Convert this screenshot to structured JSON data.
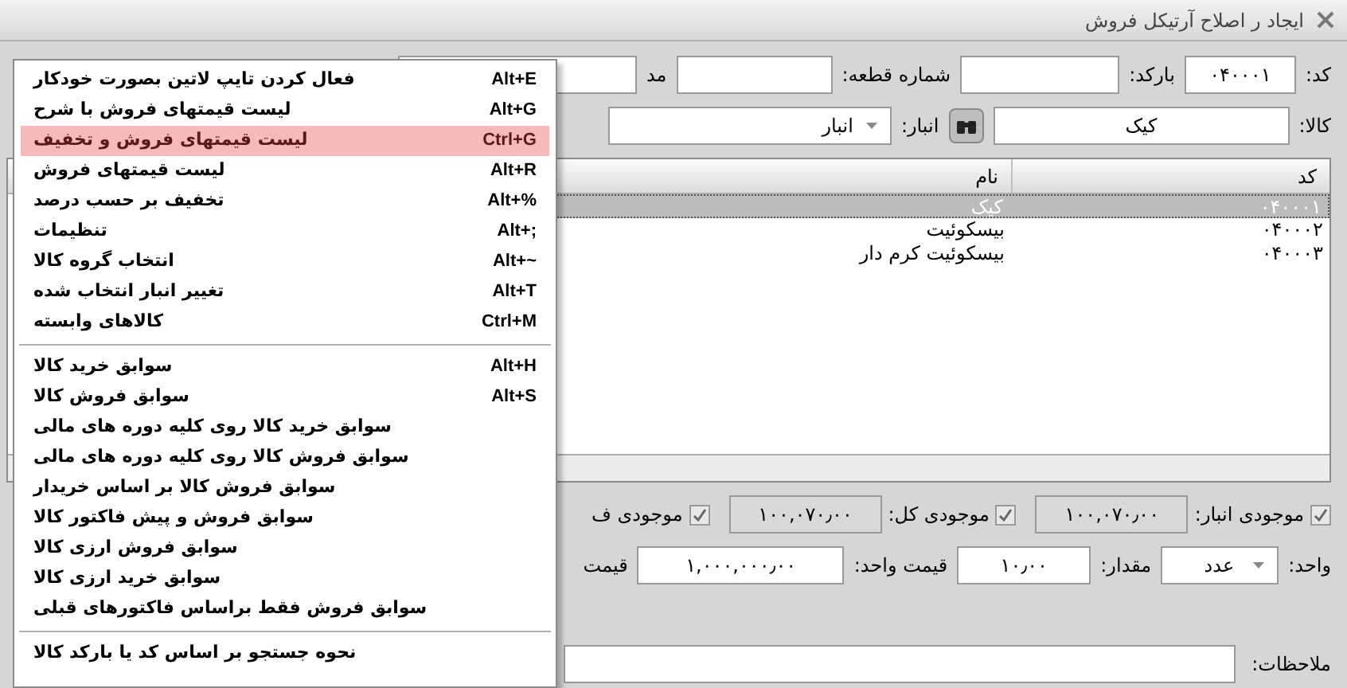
{
  "window": {
    "title": "ایجاد ر اصلاح آرتیکل فروش"
  },
  "row1": [
    {
      "label": "کد:",
      "value": "۰۴۰۰۰۱"
    },
    {
      "label": "بارکد:"
    },
    {
      "label": "شماره قطعه:"
    },
    {
      "label": "مد"
    }
  ],
  "item": {
    "label": "کالا:",
    "value": "کیک"
  },
  "warehouse": {
    "label": "انبار:",
    "value": "انبار"
  },
  "table": {
    "columns": [
      "کد",
      "نام"
    ],
    "rows": [
      {
        "code": "۰۴۰۰۰۱",
        "name": "کیک",
        "selected": true
      },
      {
        "code": "۰۴۰۰۰۲",
        "name": "بیسکوئیت",
        "selected": false
      },
      {
        "code": "۰۴۰۰۰۳",
        "name": "بیسکوئیت کرم دار",
        "selected": false
      }
    ]
  },
  "stock": [
    {
      "label": "موجودی انبار:",
      "checked": true,
      "value": "۱۰۰,۰۷۰٫۰۰"
    },
    {
      "label": "موجودی کل:",
      "checked": true,
      "value": "۱۰۰,۰۷۰٫۰۰"
    },
    {
      "label": "موجودی ف",
      "checked": true
    }
  ],
  "unit": {
    "label": "واحد:",
    "value": "عدد"
  },
  "quantity": {
    "label": "مقدار:",
    "value": "۱۰٫۰۰"
  },
  "unit_price": {
    "label": "قیمت واحد:",
    "value": "۱,۰۰۰,۰۰۰٫۰۰"
  },
  "price_cut": "قیمت",
  "notes": {
    "label": "ملاحظات:"
  },
  "context_menu": {
    "groups": [
      [
        {
          "label": "فعال کردن تایپ لاتین بصورت خودکار",
          "shortcut": "Alt+E",
          "selected": false
        },
        {
          "label": "لیست قیمتهای فروش با شرح",
          "shortcut": "Alt+G",
          "selected": false
        },
        {
          "label": "لیست قیمتهای فروش و تخفیف",
          "shortcut": "Ctrl+G",
          "selected": true
        },
        {
          "label": "لیست قیمتهای فروش",
          "shortcut": "Alt+R",
          "selected": false
        },
        {
          "label": "تخفیف بر حسب درصد",
          "shortcut": "Alt+%",
          "selected": false
        },
        {
          "label": "تنظیمات",
          "shortcut": "Alt+;",
          "selected": false
        },
        {
          "label": "انتخاب گروه کالا",
          "shortcut": "Alt+~",
          "selected": false
        },
        {
          "label": "تغییر انبار انتخاب شده",
          "shortcut": "Alt+T",
          "selected": false
        },
        {
          "label": "کالاهای وابسته",
          "shortcut": "Ctrl+M",
          "selected": false
        }
      ],
      [
        {
          "label": "سوابق خرید کالا",
          "shortcut": "Alt+H",
          "selected": false
        },
        {
          "label": "سوابق فروش کالا",
          "shortcut": "Alt+S",
          "selected": false
        },
        {
          "label": "سوابق خرید کالا روی کلیه دوره های مالی",
          "selected": false
        },
        {
          "label": "سوابق فروش کالا روی کلیه دوره های مالی",
          "selected": false
        },
        {
          "label": "سوابق فروش کالا بر اساس خریدار",
          "selected": false
        },
        {
          "label": "سوابق فروش و پیش فاکتور کالا",
          "selected": false
        },
        {
          "label": "سوابق فروش ارزی کالا",
          "selected": false
        },
        {
          "label": "سوابق خرید ارزی کالا",
          "selected": false
        },
        {
          "label": "سوابق فروش فقط براساس فاکتورهای قبلی",
          "selected": false
        }
      ],
      [
        {
          "label": "نحوه جستجو بر اساس کد یا بارکد کالا",
          "selected": false
        }
      ]
    ]
  }
}
